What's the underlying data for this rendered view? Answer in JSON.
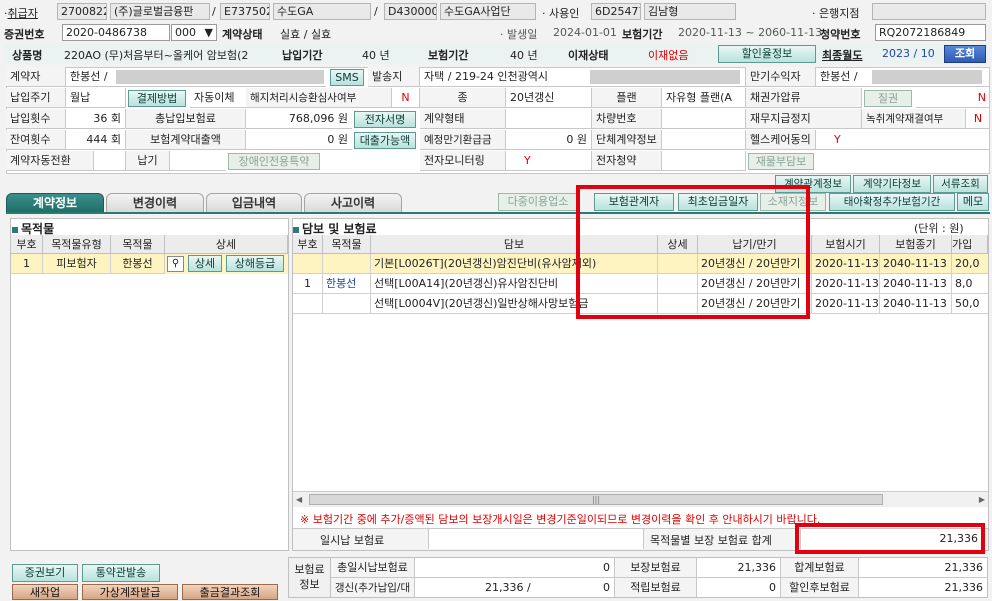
{
  "top": {
    "broker_lbl": "취급자",
    "broker_code": "2700822",
    "broker_name": "(주)글로벌금융판",
    "emp_code": "E737502",
    "emp_name": "수도GA",
    "dept_code": "D430000",
    "dept_name": "수도GA사업단",
    "user_lbl": "사용인",
    "user_code": "6D25477",
    "user_name": "김남형",
    "bank_lbl": "은행지점"
  },
  "row2": {
    "policy_lbl": "증권번호",
    "policy_no": "2020-0486738",
    "policy_seq": "000",
    "status_lbl": "계약상태",
    "status_val": "실효 / 실효",
    "issue_lbl": "발생일",
    "issue_val": "2024-01-01",
    "period_lbl": "보험기간",
    "period_val": "2020-11-13 ~ 2060-11-13",
    "sub_lbl": "청약번호",
    "sub_val": "RQ2072186849"
  },
  "row3": {
    "product_lbl": "상품명",
    "product_val": "220AO (무)처음부터~올케어 암보험(2",
    "pay_period_lbl": "납입기간",
    "pay_period_val": "40 년",
    "ins_period_lbl": "보험기간",
    "ins_period_val": "40 년",
    "transfer_lbl": "이재상태",
    "transfer_val": "이재없음",
    "discount_btn": "할인율정보",
    "last_month_lbl": "최종월도",
    "last_month_val": "2023 / 10",
    "search_btn": "조회"
  },
  "info": {
    "contractor_lbl": "계약자",
    "contractor_val": "한봉선 /",
    "sms_btn": "SMS",
    "send_lbl": "발송지",
    "send_val": "자택",
    "addr": "/ 219-24  인천광역시",
    "maturity_lbl": "만기수익자",
    "maturity_val": "한봉선 /",
    "pay_cycle_lbl": "납입주기",
    "pay_cycle_val": "월납",
    "pay_method_btn": "결제방법",
    "auto_val": "자동이체",
    "cancel_lbl": "해지처리시승환심사여부",
    "cancel_val": "N",
    "kind_lbl": "종",
    "kind_val": "20년갱신",
    "plan_lbl": "플랜",
    "plan_val": "자유형 플랜(A",
    "bond_lbl": "채권가압류",
    "disease_btn": "질권",
    "bond_val": "N",
    "pay_count_lbl": "납입횟수",
    "pay_count_val": "36 회",
    "total_prem_lbl": "총납입보험료",
    "total_prem_val": "768,096 원",
    "esign_btn": "전자서명",
    "contract_form_lbl": "계약형태",
    "car_lbl": "차량번호",
    "dep_lbl": "재무지급정지",
    "cancel_contract_lbl": "녹취계약재결여부",
    "cancel_contract_val": "N",
    "remain_lbl": "잔여횟수",
    "remain_val": "444 회",
    "loan_lbl": "보험계약대출액",
    "loan_val": "0 원",
    "loan_btn": "대출가능액",
    "exp_refund_lbl": "예정만기환급금",
    "exp_refund_val": "0 원",
    "group_lbl": "단체계약정보",
    "health_lbl": "헬스케어동의",
    "health_val": "Y",
    "auto_change_lbl": "계약자동전환",
    "pay_lbl": "납기",
    "disability_btn": "장애인전용특약",
    "monitor_lbl": "전자모니터링",
    "monitor_val": "Y",
    "e_sub_lbl": "전자청약",
    "rebill_btn": "재물부담보"
  },
  "side_btns": [
    "계약관계정보",
    "계약기타정보",
    "서류조회"
  ],
  "tabs": [
    "계약정보",
    "변경이력",
    "입금내역",
    "사고이력"
  ],
  "action_btns": [
    "다중이용업소",
    "보험관계자",
    "최초입금일자",
    "소재지정보",
    "태아확정추가보험기간",
    "메모"
  ],
  "left": {
    "title": "목적물",
    "headers": [
      "부호",
      "목적물유형",
      "목적물",
      "상세"
    ],
    "row": {
      "no": "1",
      "type": "피보험자",
      "name": "한봉선",
      "detail_btn": "상세",
      "sub_btn": "상해등급"
    }
  },
  "right": {
    "title": "담보 및 보험료",
    "unit": "(단위 :    원)",
    "headers": [
      "부호",
      "목적물",
      "담보",
      "상세",
      "납기/만기",
      "보험시기",
      "보험종기",
      "가입"
    ],
    "rows": [
      {
        "no": "",
        "target": "",
        "coverage": "기본[L0026T](20년갱신)암진단비(유사암제외)",
        "term": "20년갱신 / 20년만기",
        "start": "2020-11-13",
        "end": "2040-11-13",
        "amt": "20,0"
      },
      {
        "no": "1",
        "target": "한봉선",
        "coverage": "선택[L00A14](20년갱신)유사암진단비",
        "term": "20년갱신 / 20년만기",
        "start": "2020-11-13",
        "end": "2040-11-13",
        "amt": "8,0"
      },
      {
        "no": "",
        "target": "",
        "coverage": "선택[L0004V](20년갱신)일반상해사망보험금",
        "term": "20년갱신 / 20년만기",
        "start": "2020-11-13",
        "end": "2040-11-13",
        "amt": "50,0"
      }
    ],
    "notice": "※ 보험기간 중에 추가/증액된 담보의 보장개시일은 변경기준일이되므로 변경이력을 확인 후 안내하시기 바랍니다.",
    "lump_lbl": "일시납 보험료",
    "sum_lbl": "목적물별 보장 보험료 합계",
    "sum_val": "21,336"
  },
  "bottom_btns": [
    "증권보기",
    "통약관발송",
    "새작업",
    "가상계좌발급",
    "출금결과조회"
  ],
  "prem": {
    "title": "보험료 정보",
    "r1": {
      "a_lbl": "총일시납보험료",
      "a_val": "0",
      "b_lbl": "보장보험료",
      "b_val": "21,336",
      "c_lbl": "합계보험료",
      "c_val": "21,336"
    },
    "r2": {
      "a_lbl": "갱신(추가납입/대체)",
      "a_val1": "21,336 /",
      "a_val2": "0",
      "b_lbl": "적립보험료",
      "b_val": "0",
      "c_lbl": "할인후보험료",
      "c_val": "21,336"
    }
  }
}
